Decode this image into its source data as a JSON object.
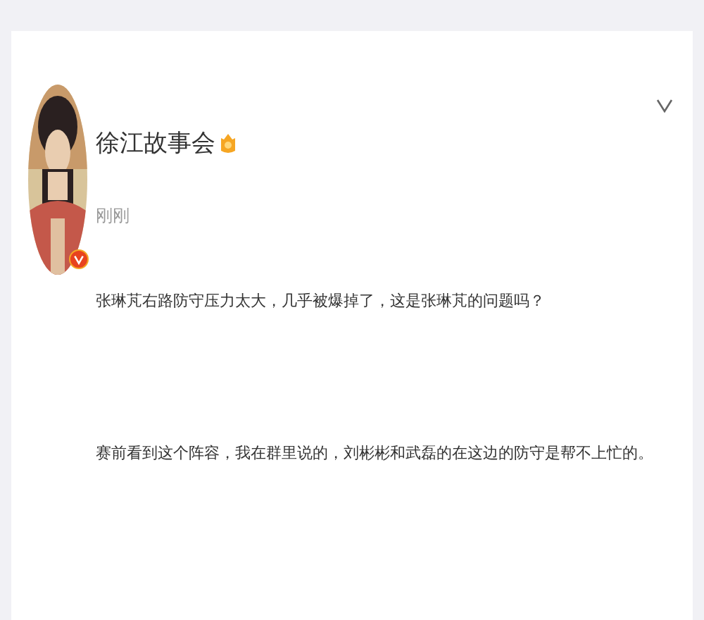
{
  "post": {
    "author": "徐江故事会",
    "time": "刚刚",
    "verified": true,
    "paragraphs": [
      "张琳芃右路防守压力太大，几乎被爆掉了，这是张琳芃的问题吗？",
      "赛前看到这个阵容，我在群里说的，刘彬彬和武磊的在这边的防守是帮不上忙的。"
    ]
  }
}
